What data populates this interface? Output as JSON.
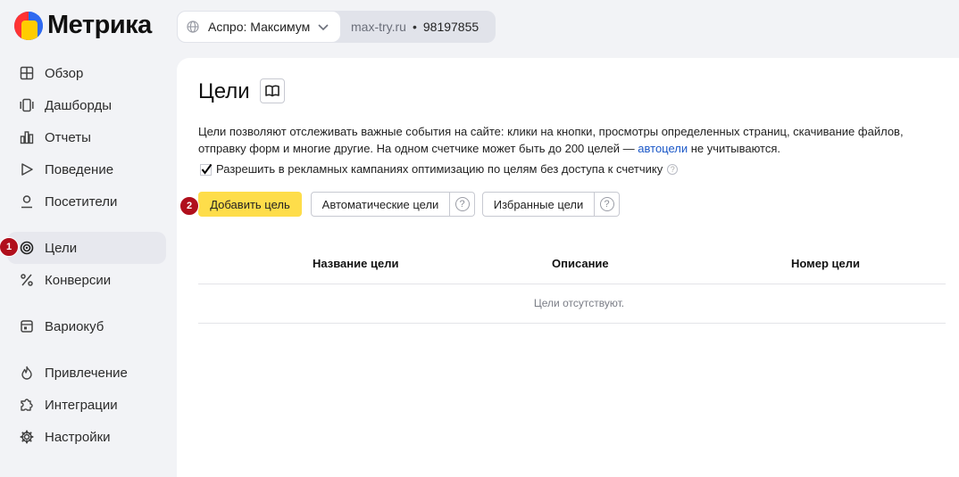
{
  "app": {
    "name": "Метрика"
  },
  "counter": {
    "name": "Аспро: Максимум",
    "site": "max-try.ru",
    "separator": "•",
    "id": "98197855"
  },
  "sidebar": {
    "items": [
      {
        "label": "Обзор",
        "icon": "grid-icon"
      },
      {
        "label": "Дашборды",
        "icon": "dashboards-icon"
      },
      {
        "label": "Отчеты",
        "icon": "bar-chart-icon"
      },
      {
        "label": "Поведение",
        "icon": "play-icon"
      },
      {
        "label": "Посетители",
        "icon": "person-icon"
      },
      {
        "label": "Цели",
        "icon": "target-icon",
        "active": true
      },
      {
        "label": "Конверсии",
        "icon": "percent-icon"
      },
      {
        "label": "Вариокуб",
        "icon": "variocube-icon"
      },
      {
        "label": "Привлечение",
        "icon": "flame-icon"
      },
      {
        "label": "Интеграции",
        "icon": "puzzle-icon"
      },
      {
        "label": "Настройки",
        "icon": "gear-icon"
      }
    ]
  },
  "badges": {
    "first": "1",
    "second": "2"
  },
  "page": {
    "title": "Цели",
    "description_part1": "Цели позволяют отслеживать важные события на сайте: клики на кнопки, просмотры определенных страниц, скачивание файлов, отправку форм и многие другие. На одном счетчике может быть до 200 целей — ",
    "description_link": "автоцели",
    "description_part2": " не учитываются.",
    "checkbox_label": "Разрешить в рекламных кампаниях оптимизацию по целям без доступа к счетчику",
    "checkbox_checked": true,
    "help_glyph": "?",
    "buttons": {
      "add": "Добавить цель",
      "auto": "Автоматические цели",
      "favorite": "Избранные цели"
    },
    "table": {
      "columns": [
        "Название цели",
        "Описание",
        "Номер цели"
      ],
      "empty_text": "Цели отсутствуют."
    }
  },
  "colors": {
    "accent": "#fedd4a",
    "badge": "#b00f1c",
    "link": "#1a57c7"
  }
}
